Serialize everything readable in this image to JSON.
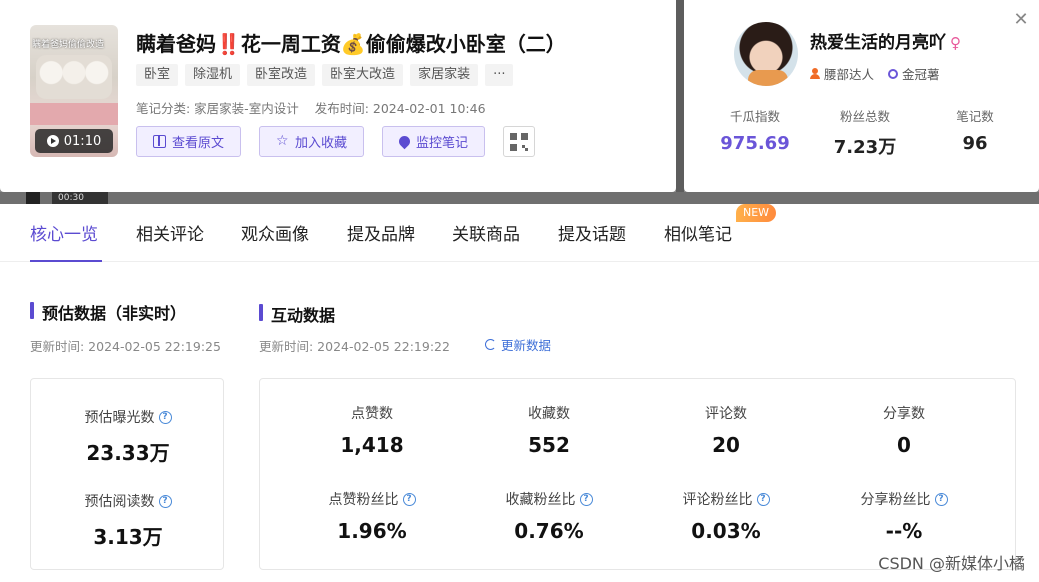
{
  "note": {
    "title": "瞒着爸妈‼️花一周工资💰偷偷爆改小卧室（二）",
    "cover_text": "瞒着爸妈偷偷改造",
    "duration": "01:10",
    "tags": [
      "卧室",
      "除湿机",
      "卧室改造",
      "卧室大改造",
      "家居家装",
      "···"
    ],
    "category": "笔记分类: 家居家装-室内设计",
    "publish_time": "发布时间:  2024-02-01 10:46",
    "actions": {
      "view_original": "查看原文",
      "add_favorite": "加入收藏",
      "monitor_note": "监控笔记"
    }
  },
  "author": {
    "name": "热爱生活的月亮吖",
    "gender_symbol": "♀",
    "badge_1": "腰部达人",
    "badge_2": "金冠薯",
    "stats": [
      {
        "label": "千瓜指数",
        "value": "975.69"
      },
      {
        "label": "粉丝总数",
        "value": "7.23万"
      },
      {
        "label": "笔记数",
        "value": "96"
      }
    ]
  },
  "tabs": [
    "核心一览",
    "相关评论",
    "观众画像",
    "提及品牌",
    "关联商品",
    "提及话题",
    "相似笔记"
  ],
  "new_badge": "NEW",
  "estimate": {
    "title": "预估数据（非实时）",
    "updated": "更新时间:  2024-02-05 22:19:25",
    "exposure_label": "预估曝光数",
    "exposure_value": "23.33万",
    "read_label": "预估阅读数",
    "read_value": "3.13万"
  },
  "interaction": {
    "title": "互动数据",
    "updated": "更新时间:  2024-02-05 22:19:22",
    "refresh_label": "更新数据",
    "metrics": [
      {
        "label": "点赞数",
        "value": "1,418"
      },
      {
        "label": "收藏数",
        "value": "552"
      },
      {
        "label": "评论数",
        "value": "20"
      },
      {
        "label": "分享数",
        "value": "0"
      }
    ],
    "ratios": [
      {
        "label": "点赞粉丝比",
        "value": "1.96%"
      },
      {
        "label": "收藏粉丝比",
        "value": "0.76%"
      },
      {
        "label": "评论粉丝比",
        "value": "0.03%"
      },
      {
        "label": "分享粉丝比",
        "value": "--%"
      }
    ]
  },
  "background": {
    "video_time": "00:30"
  },
  "watermark": "CSDN @新媒体小橘",
  "colors": {
    "accent": "#5b4bd1",
    "link": "#3e6fd8",
    "badge_orange": "#ff8a3d"
  }
}
